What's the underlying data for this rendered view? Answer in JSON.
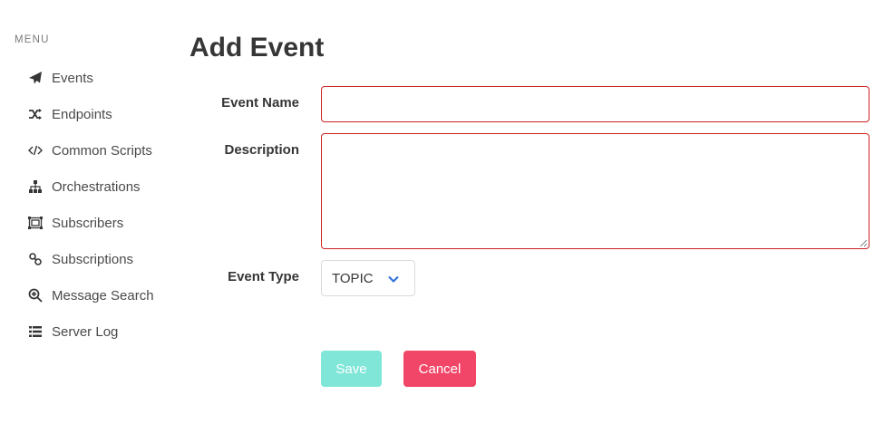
{
  "sidebar": {
    "menu_label": "MENU",
    "items": [
      {
        "label": "Events",
        "icon": "paper-plane-icon"
      },
      {
        "label": "Endpoints",
        "icon": "random-icon"
      },
      {
        "label": "Common Scripts",
        "icon": "code-icon"
      },
      {
        "label": "Orchestrations",
        "icon": "sitemap-icon"
      },
      {
        "label": "Subscribers",
        "icon": "object-group-icon"
      },
      {
        "label": "Subscriptions",
        "icon": "link-icon"
      },
      {
        "label": "Message Search",
        "icon": "search-plus-icon"
      },
      {
        "label": "Server Log",
        "icon": "list-icon"
      }
    ]
  },
  "form": {
    "title": "Add Event",
    "event_name_label": "Event Name",
    "event_name_value": "",
    "description_label": "Description",
    "description_value": "",
    "event_type_label": "Event Type",
    "event_type_value": "TOPIC",
    "save_label": "Save",
    "cancel_label": "Cancel"
  },
  "colors": {
    "error_border": "#cc2222",
    "save_button": "#7fe6d8",
    "cancel_button": "#f14668",
    "chevron": "#3273dc"
  }
}
